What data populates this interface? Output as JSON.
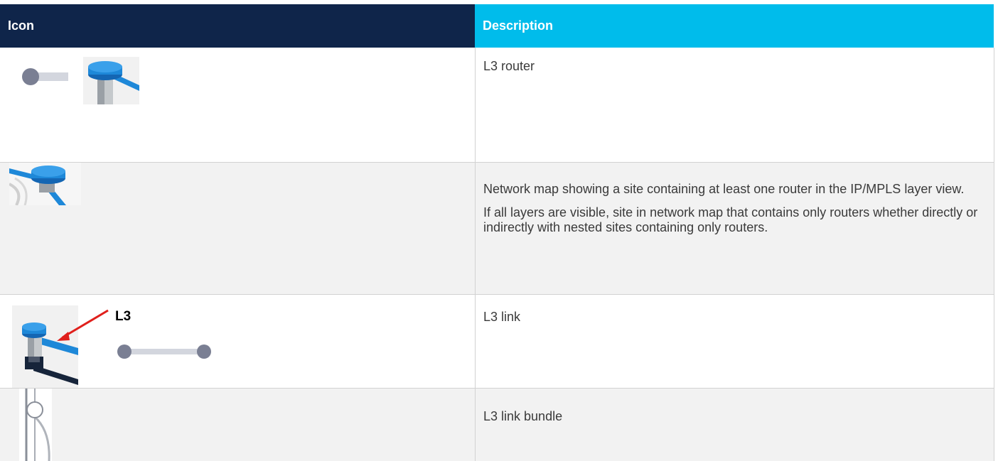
{
  "table": {
    "headers": {
      "icon": "Icon",
      "description": "Description"
    },
    "rows": [
      {
        "icon_names": [
          "router-node-icon",
          "router-3d-icon"
        ],
        "description": [
          "L3 router"
        ]
      },
      {
        "icon_names": [
          "site-router-map-icon"
        ],
        "description": [
          "Network map showing a site containing at least one router in the IP/MPLS layer view.",
          "If all layers are visible, site in network map that contains only routers whether directly or indirectly with nested sites containing only routers."
        ]
      },
      {
        "icon_names": [
          "router-link-3d-icon",
          "link-line-icon"
        ],
        "callout": "L3",
        "description": [
          "L3 link"
        ]
      },
      {
        "icon_names": [
          "link-bundle-icon"
        ],
        "description": [
          "L3 link bundle"
        ]
      }
    ]
  },
  "colors": {
    "header_dark": "#0f254a",
    "header_accent": "#00bceb",
    "router_blue": "#1e88d8",
    "node_gray": "#7a7f93",
    "link_gray": "#d3d6de",
    "callout_red": "#e0201c"
  }
}
